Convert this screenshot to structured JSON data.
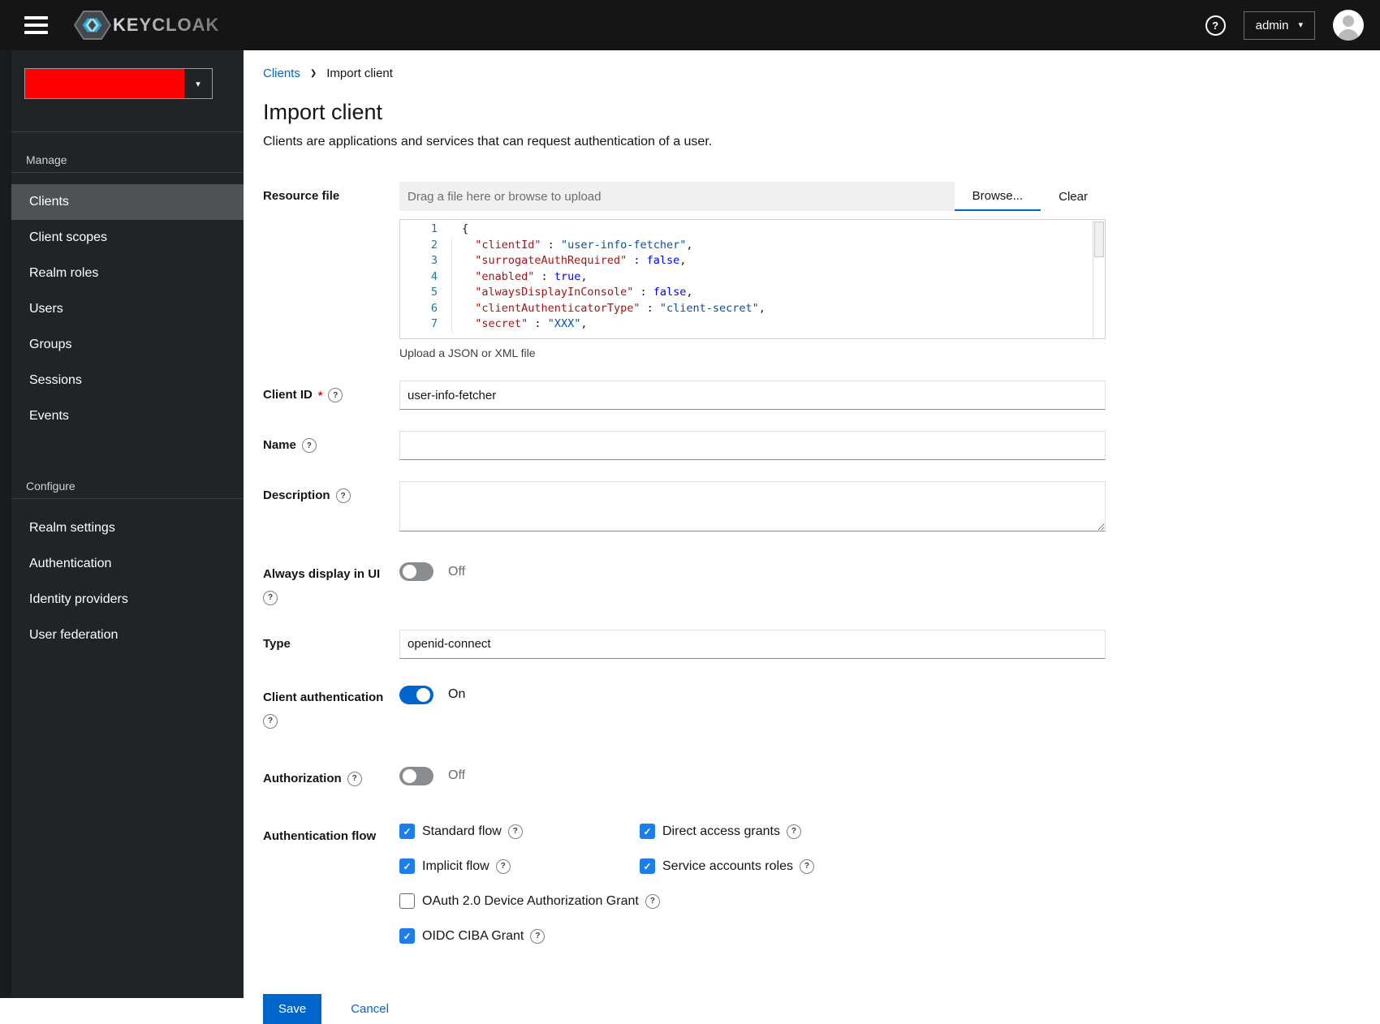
{
  "icons": {
    "help": "?",
    "caret_down": "▾",
    "breadcrumb_sep": "❯",
    "check": "✓"
  },
  "colors": {
    "accent": "#0066cc",
    "checkbox_checked": "#1d7dea",
    "nav_selected_border": "#4a9de8",
    "realm_redacted": "#ff0000",
    "editor_key": "#a31515",
    "editor_string": "#0451a5",
    "editor_keyword": "#0000ff",
    "editor_line_number": "#237893"
  },
  "header": {
    "brand": "KEYCLOAK",
    "user": "admin"
  },
  "sidebar": {
    "groups": [
      {
        "label": "Manage",
        "selected": "Clients",
        "items": [
          "Clients",
          "Client scopes",
          "Realm roles",
          "Users",
          "Groups",
          "Sessions",
          "Events"
        ]
      },
      {
        "label": "Configure",
        "selected": "",
        "items": [
          "Realm settings",
          "Authentication",
          "Identity providers",
          "User federation"
        ]
      }
    ]
  },
  "breadcrumb": {
    "link": "Clients",
    "current": "Import client"
  },
  "page": {
    "title": "Import client",
    "subtitle": "Clients are applications and services that can request authentication of a user."
  },
  "form": {
    "resource_file": {
      "label": "Resource file",
      "placeholder": "Drag a file here or browse to upload",
      "browse": "Browse...",
      "clear": "Clear",
      "helper": "Upload a JSON or XML file"
    },
    "editor": {
      "lines": [
        [
          [
            "p",
            "{"
          ]
        ],
        [
          [
            "p",
            "  "
          ],
          [
            "k",
            "\"clientId\""
          ],
          [
            "p",
            " : "
          ],
          [
            "s",
            "\"user-info-fetcher\""
          ],
          [
            "p",
            ","
          ]
        ],
        [
          [
            "p",
            "  "
          ],
          [
            "k",
            "\"surrogateAuthRequired\""
          ],
          [
            "p",
            " : "
          ],
          [
            "b",
            "false"
          ],
          [
            "p",
            ","
          ]
        ],
        [
          [
            "p",
            "  "
          ],
          [
            "k",
            "\"enabled\""
          ],
          [
            "p",
            " : "
          ],
          [
            "b",
            "true"
          ],
          [
            "p",
            ","
          ]
        ],
        [
          [
            "p",
            "  "
          ],
          [
            "k",
            "\"alwaysDisplayInConsole\""
          ],
          [
            "p",
            " : "
          ],
          [
            "b",
            "false"
          ],
          [
            "p",
            ","
          ]
        ],
        [
          [
            "p",
            "  "
          ],
          [
            "k",
            "\"clientAuthenticatorType\""
          ],
          [
            "p",
            " : "
          ],
          [
            "s",
            "\"client-secret\""
          ],
          [
            "p",
            ","
          ]
        ],
        [
          [
            "p",
            "  "
          ],
          [
            "k",
            "\"secret\""
          ],
          [
            "p",
            " : "
          ],
          [
            "s",
            "\"XXX\""
          ],
          [
            "p",
            ","
          ]
        ]
      ]
    },
    "client_id": {
      "label": "Client ID",
      "required": "*",
      "value": "user-info-fetcher"
    },
    "name": {
      "label": "Name",
      "value": ""
    },
    "description": {
      "label": "Description",
      "value": ""
    },
    "always_display": {
      "label": "Always display in UI",
      "state": "Off"
    },
    "type": {
      "label": "Type",
      "value": "openid-connect"
    },
    "client_auth": {
      "label": "Client authentication",
      "state": "On"
    },
    "authorization": {
      "label": "Authorization",
      "state": "Off"
    },
    "auth_flow": {
      "label": "Authentication flow",
      "options": [
        {
          "label": "Standard flow",
          "checked": true
        },
        {
          "label": "Direct access grants",
          "checked": true
        },
        {
          "label": "Implicit flow",
          "checked": true
        },
        {
          "label": "Service accounts roles",
          "checked": true
        },
        {
          "label": "OAuth 2.0 Device Authorization Grant",
          "checked": false
        },
        {
          "label": "OIDC CIBA Grant",
          "checked": true
        }
      ]
    },
    "actions": {
      "save": "Save",
      "cancel": "Cancel"
    }
  }
}
